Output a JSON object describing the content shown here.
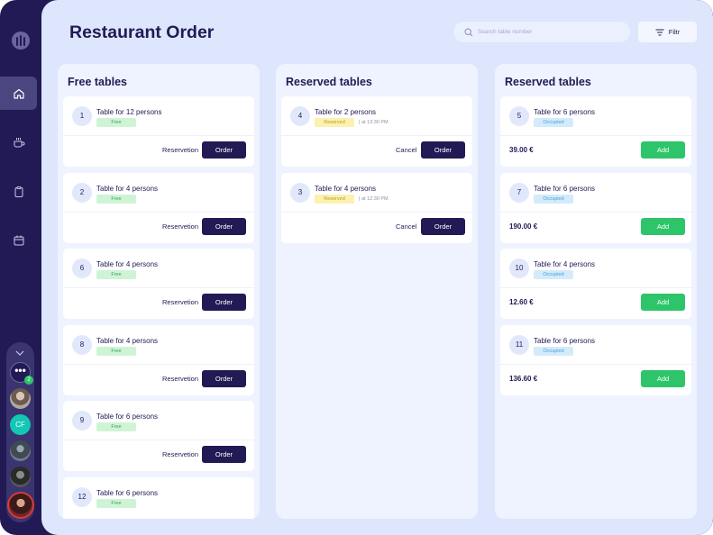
{
  "page_title": "Restaurant Order",
  "search": {
    "placeholder": "Search table number"
  },
  "filter_label": "Filtr",
  "sidebar": {
    "items": [
      {
        "icon": "home-icon",
        "active": true
      },
      {
        "icon": "coffee-icon",
        "active": false
      },
      {
        "icon": "clipboard-icon",
        "active": false
      },
      {
        "icon": "calendar-icon",
        "active": false
      }
    ],
    "people": {
      "more_label": "•••",
      "more_badge": "2",
      "cf_initials": "CF"
    }
  },
  "columns": [
    {
      "title": "Free tables",
      "cards": [
        {
          "num": "1",
          "name": "Table for 12 persons",
          "status": "Free",
          "secondary": "Reservetion",
          "primary": "Order"
        },
        {
          "num": "2",
          "name": "Table for 4 persons",
          "status": "Free",
          "secondary": "Reservetion",
          "primary": "Order"
        },
        {
          "num": "6",
          "name": "Table for 4 persons",
          "status": "Free",
          "secondary": "Reservetion",
          "primary": "Order"
        },
        {
          "num": "8",
          "name": "Table for 4 persons",
          "status": "Free",
          "secondary": "Reservetion",
          "primary": "Order"
        },
        {
          "num": "9",
          "name": "Table for 6 persons",
          "status": "Free",
          "secondary": "Reservetion",
          "primary": "Order"
        },
        {
          "num": "12",
          "name": "Table for 6 persons",
          "status": "Free"
        }
      ]
    },
    {
      "title": "Reserved tables",
      "cards": [
        {
          "num": "4",
          "name": "Table for 2 persons",
          "status": "Reserved",
          "time": "| at 13:30 PM",
          "secondary": "Cancel",
          "primary": "Order"
        },
        {
          "num": "3",
          "name": "Table for 4 persons",
          "status": "Reserved",
          "time": "| at 12:30 PM",
          "secondary": "Cancel",
          "primary": "Order"
        }
      ]
    },
    {
      "title": "Reserved tables",
      "cards": [
        {
          "num": "5",
          "name": "Table for 6 persons",
          "status": "Occupied",
          "price": "39.00 €",
          "primary": "Add"
        },
        {
          "num": "7",
          "name": "Table for 6 persons",
          "status": "Occupied",
          "price": "190.00 €",
          "primary": "Add"
        },
        {
          "num": "10",
          "name": "Table for 4 persons",
          "status": "Occupied",
          "price": "12.60 €",
          "primary": "Add"
        },
        {
          "num": "11",
          "name": "Table for 6 persons",
          "status": "Occupied",
          "price": "136.60 €",
          "primary": "Add"
        }
      ]
    }
  ],
  "colors": {
    "navy": "#221a55",
    "green": "#2ec56a",
    "background": "#dde6fc"
  }
}
